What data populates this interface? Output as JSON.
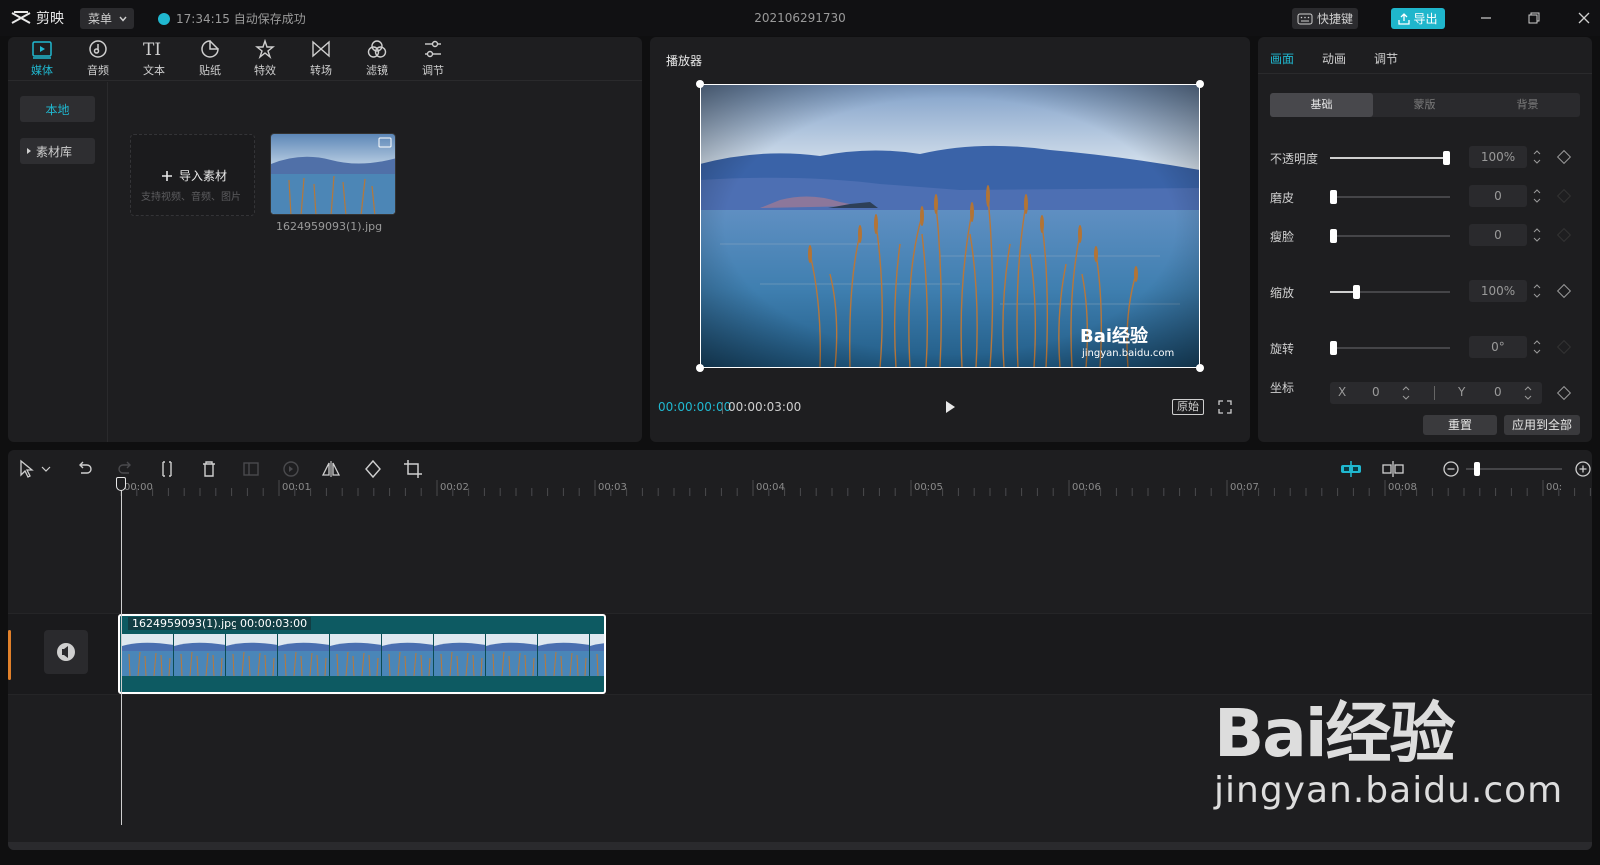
{
  "app": {
    "name": "剪映",
    "menu_label": "菜单",
    "save_status": "17:34:15 自动保存成功",
    "project_title": "202106291730",
    "shortcut_label": "快捷键",
    "export_label": "导出"
  },
  "media_panel": {
    "tabs": [
      {
        "label": "媒体",
        "icon": "media-icon",
        "active": true
      },
      {
        "label": "音频",
        "icon": "audio-icon",
        "active": false
      },
      {
        "label": "文本",
        "icon": "text-icon",
        "active": false
      },
      {
        "label": "贴纸",
        "icon": "sticker-icon",
        "active": false
      },
      {
        "label": "特效",
        "icon": "effects-icon",
        "active": false
      },
      {
        "label": "转场",
        "icon": "transition-icon",
        "active": false
      },
      {
        "label": "滤镜",
        "icon": "filter-icon",
        "active": false
      },
      {
        "label": "调节",
        "icon": "adjust-icon",
        "active": false
      }
    ],
    "side": {
      "local": "本地",
      "library": "素材库"
    },
    "import": {
      "label": "导入素材",
      "hint": "支持视频、音频、图片"
    },
    "items": [
      {
        "name": "1624959093(1).jpg"
      }
    ]
  },
  "player": {
    "title": "播放器",
    "current_time": "00:00:00:00",
    "total_time": "00:00:03:00",
    "ratio_label": "原始",
    "preview_watermark": "Bai经验",
    "preview_watermark_url": "jingyan.baidu.com"
  },
  "properties": {
    "tabs": [
      {
        "label": "画面",
        "active": true
      },
      {
        "label": "动画",
        "active": false
      },
      {
        "label": "调节",
        "active": false
      }
    ],
    "segments": [
      {
        "label": "基础",
        "active": true
      },
      {
        "label": "蒙版",
        "active": false
      },
      {
        "label": "背景",
        "active": false
      }
    ],
    "rows": [
      {
        "label": "不透明度",
        "value": "100%",
        "level": 1.0
      },
      {
        "label": "磨皮",
        "value": "0",
        "level": 0.0
      },
      {
        "label": "瘦脸",
        "value": "0",
        "level": 0.0
      },
      {
        "label": "缩放",
        "value": "100%",
        "level": 0.2
      },
      {
        "label": "旋转",
        "value": "0°",
        "level": 0.0
      }
    ],
    "position": {
      "label": "坐标",
      "x_label": "X",
      "x": "0",
      "y_label": "Y",
      "y": "0"
    },
    "reset_label": "重置",
    "apply_all_label": "应用到全部"
  },
  "timeline": {
    "ticks": [
      "00:00",
      "00:01",
      "00:02",
      "00:03",
      "00:04",
      "00:05",
      "00:06",
      "00:07",
      "00:08",
      "00:"
    ],
    "clip": {
      "name": "1624959093(1).jpg",
      "duration": "00:00:03:00"
    }
  },
  "overlay_watermark": {
    "brand": "Bai经验",
    "url": "jingyan.baidu.com"
  },
  "colors": {
    "accent": "#20b8d0",
    "panel": "#1e1e20",
    "background": "#0f0f10",
    "clip": "#0d5a62"
  }
}
